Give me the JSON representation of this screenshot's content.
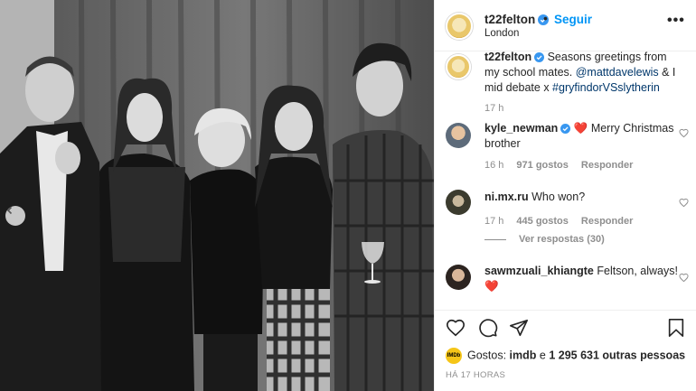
{
  "header": {
    "username": "t22felton",
    "follow_label": "Seguir",
    "separator": "•",
    "location": "London",
    "more": "•••"
  },
  "caption": {
    "username": "t22felton",
    "text_before": "Seasons greetings from my school mates. ",
    "mention": "@mattdavelewis",
    "text_mid": " & I mid debate x ",
    "hashtag": "#gryfindorVSslytherin",
    "time": "17 h"
  },
  "comments": [
    {
      "username": "kyle_newman",
      "text": "❤️ Merry Christmas brother",
      "time": "16 h",
      "likes": "971 gostos",
      "reply": "Responder"
    },
    {
      "username": "ni.mx.ru",
      "text": "Who won?",
      "time": "17 h",
      "likes": "445 gostos",
      "reply": "Responder",
      "view_replies": "Ver respostas (30)"
    },
    {
      "username": "sawmzuali_khiangte",
      "text": "Feltson, always! ❤️"
    }
  ],
  "likes": {
    "prefix": "Gostos: ",
    "user": "imdb",
    "mid": " e ",
    "others": "1 295 631 outras pessoas",
    "avatar_text": "IMDb"
  },
  "timestamp": "HÁ 17 HORAS",
  "colors": {
    "link": "#0095f6",
    "tag": "#00376b",
    "heart": "#ed4956",
    "muted": "#8e8e8e"
  },
  "icons": [
    "heart-icon",
    "comment-icon",
    "share-icon",
    "bookmark-icon",
    "chevron-left-icon",
    "verified-icon",
    "more-icon"
  ]
}
